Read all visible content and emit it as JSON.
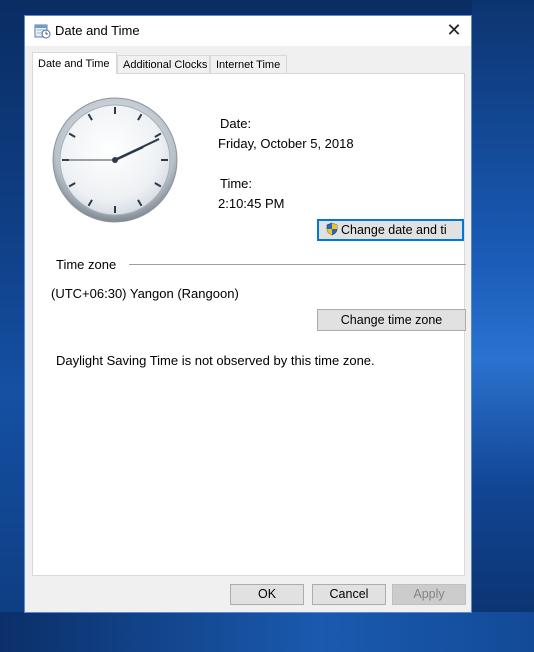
{
  "window": {
    "title": "Date and Time",
    "close_glyph": "✕"
  },
  "tabs": [
    {
      "label": "Date and Time",
      "active": true
    },
    {
      "label": "Additional Clocks",
      "active": false
    },
    {
      "label": "Internet Time",
      "active": false
    }
  ],
  "datetime": {
    "date_label": "Date:",
    "date_value": "Friday, October 5, 2018",
    "time_label": "Time:",
    "time_value": "2:10:45 PM",
    "change_button": "Change date and ti"
  },
  "clock": {
    "hour": 2,
    "minute": 10,
    "second": 45
  },
  "timezone": {
    "group_label": "Time zone",
    "value": "(UTC+06:30) Yangon (Rangoon)",
    "change_button": "Change time zone",
    "dst_note": "Daylight Saving Time is not observed by this time zone."
  },
  "footer": {
    "ok": "OK",
    "cancel": "Cancel",
    "apply": "Apply"
  },
  "icons": {
    "title_icon": "date-time-icon",
    "shield": "uac-shield-icon"
  },
  "colors": {
    "focus_border": "#0078d7",
    "window_border": "#5b8ad1"
  }
}
